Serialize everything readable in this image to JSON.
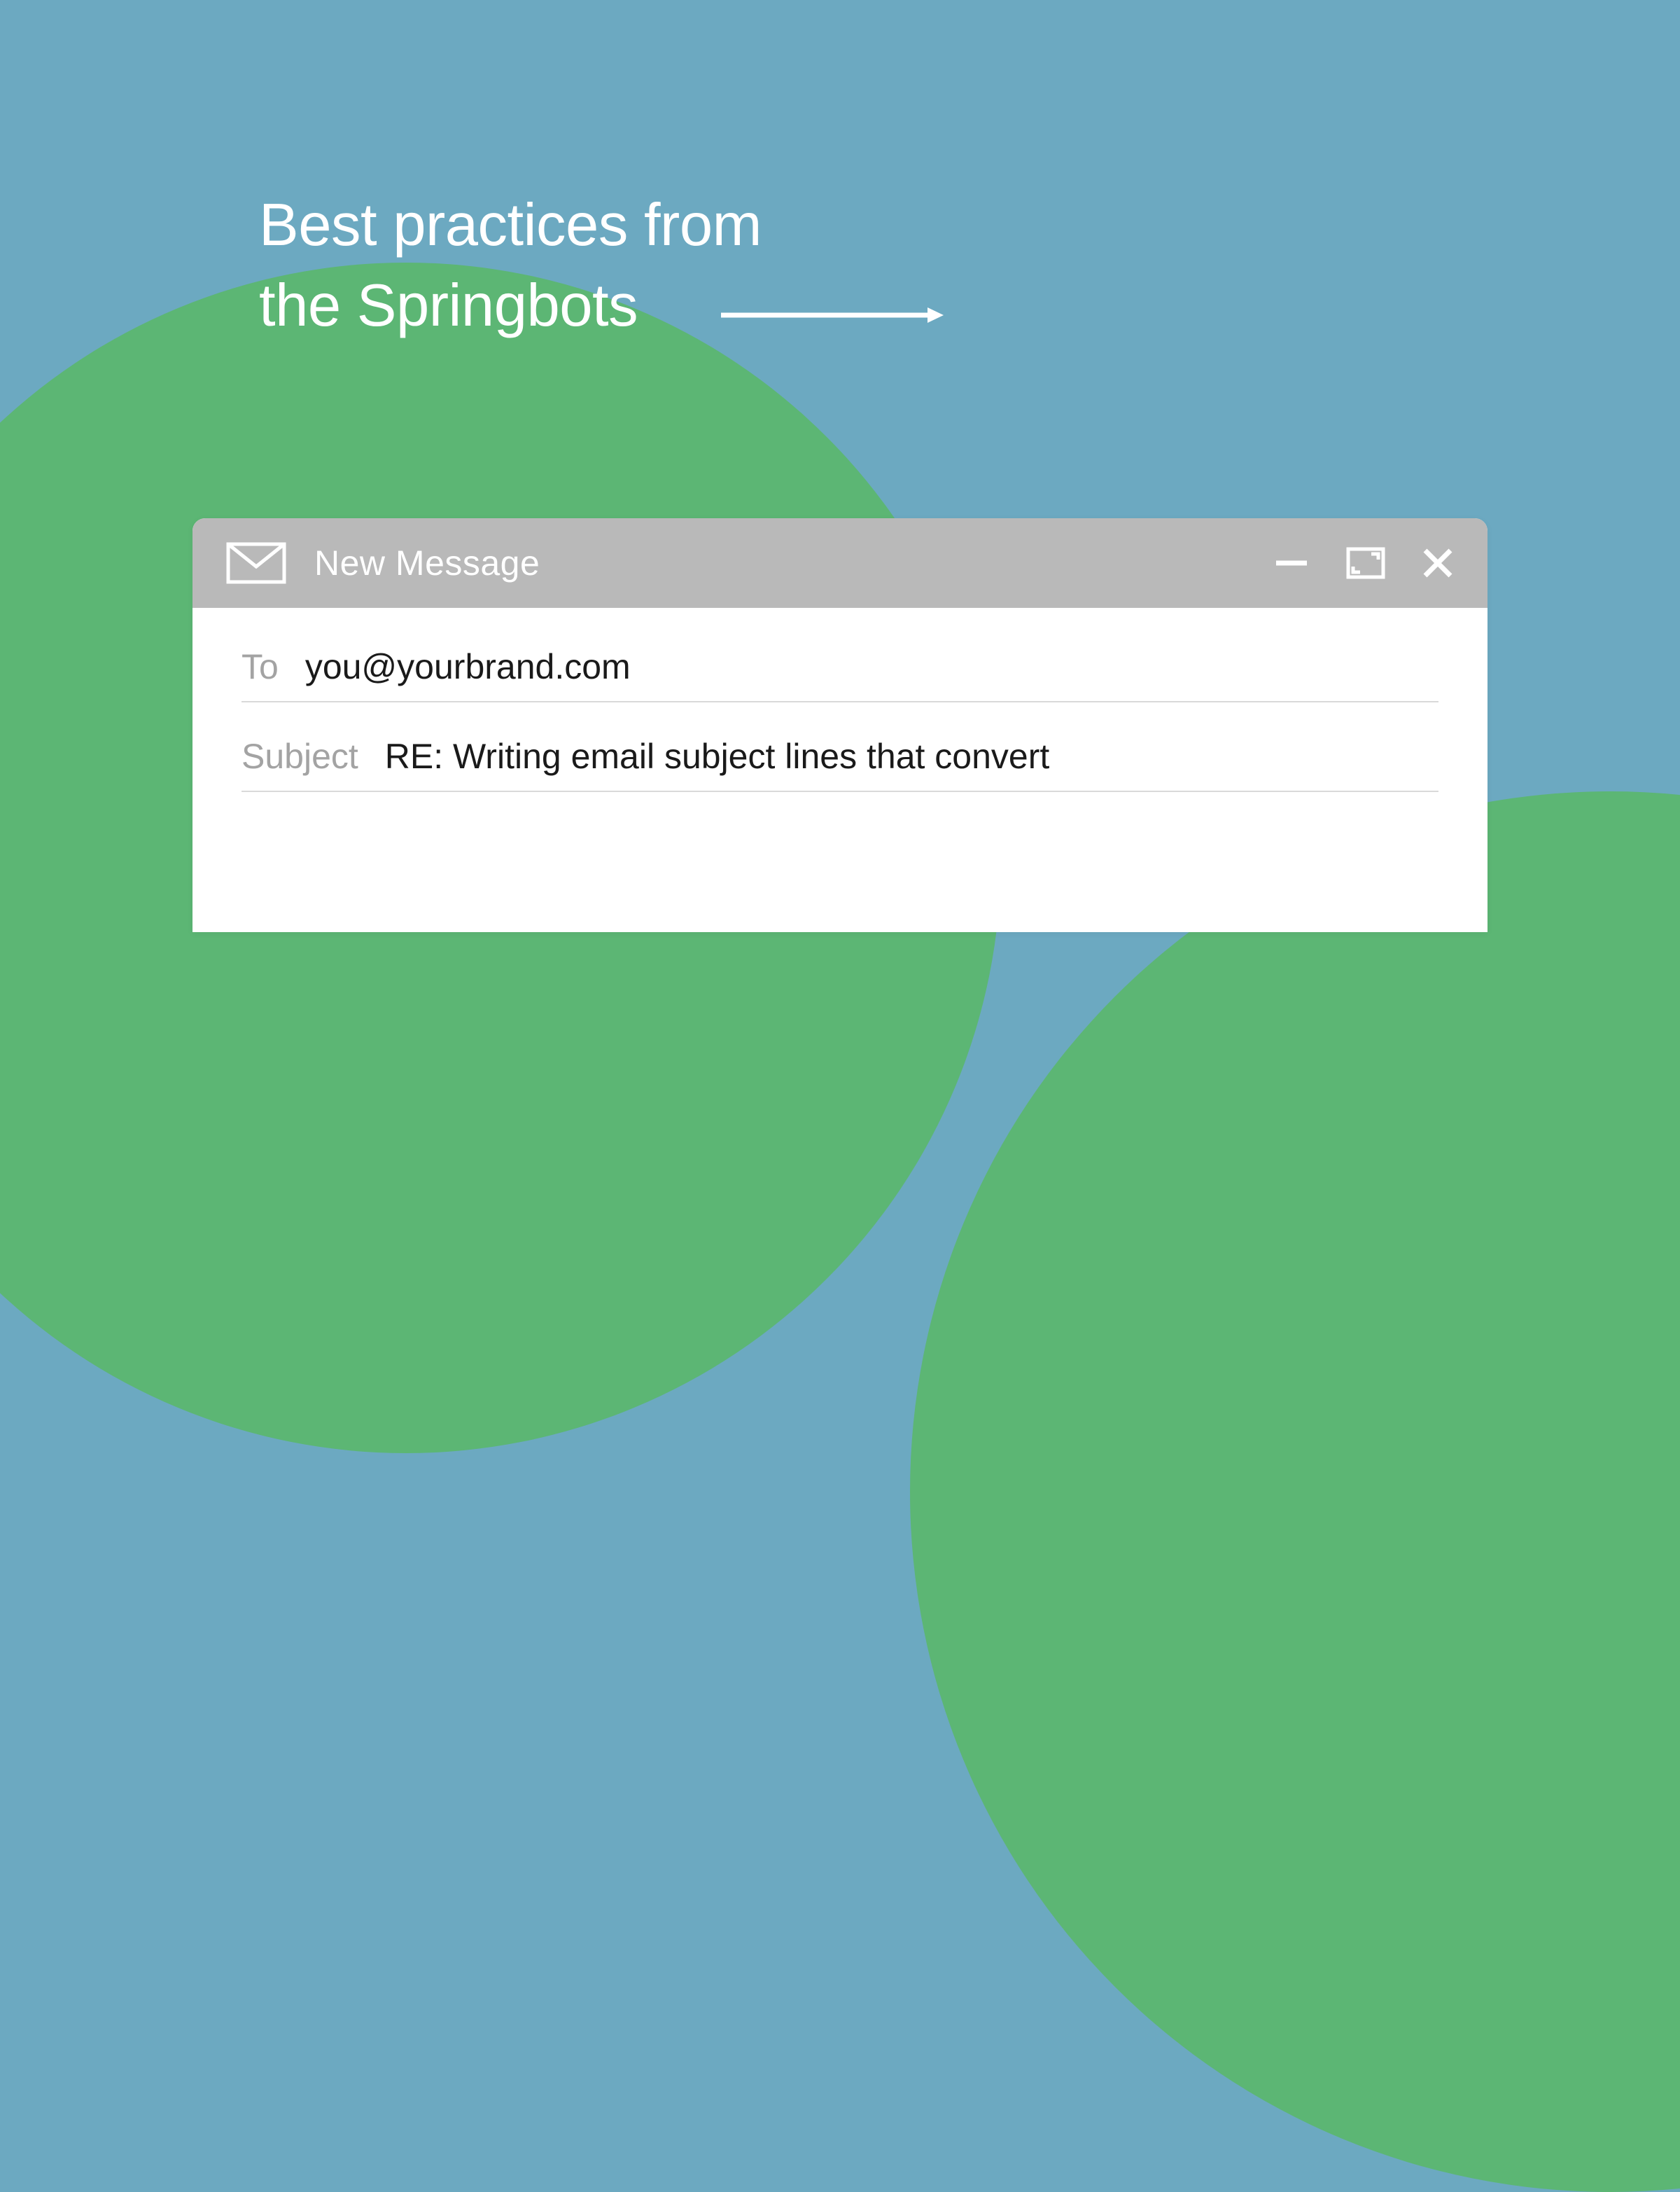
{
  "headline": {
    "line1": "Best practices from",
    "line2": "the Springbots"
  },
  "compose": {
    "title": "New Message",
    "fields": {
      "to": {
        "label": "To",
        "value": "you@yourbrand.com"
      },
      "subject": {
        "label": "Subject",
        "value": "RE: Writing email subject lines that convert"
      }
    }
  },
  "colors": {
    "background": "#6ca9c1",
    "green": "#5cb674",
    "headerGray": "#b9b9b9",
    "labelGray": "#a3a3a3",
    "white": "#ffffff",
    "text": "#1a1a1a"
  }
}
